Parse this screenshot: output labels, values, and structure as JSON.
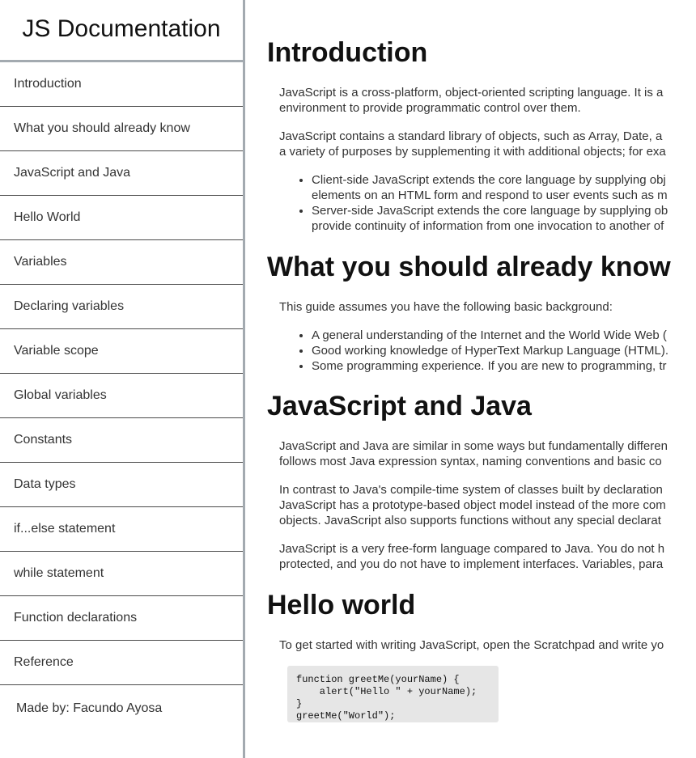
{
  "navbar": {
    "title": "JS Documentation",
    "links": [
      {
        "label": "Introduction",
        "name": "nav-link-introduction"
      },
      {
        "label": "What you should already know",
        "name": "nav-link-what-you-should-already-know"
      },
      {
        "label": "JavaScript and Java",
        "name": "nav-link-javascript-and-java"
      },
      {
        "label": "Hello World",
        "name": "nav-link-hello-world"
      },
      {
        "label": "Variables",
        "name": "nav-link-variables"
      },
      {
        "label": "Declaring variables",
        "name": "nav-link-declaring-variables"
      },
      {
        "label": "Variable scope",
        "name": "nav-link-variable-scope"
      },
      {
        "label": "Global variables",
        "name": "nav-link-global-variables"
      },
      {
        "label": "Constants",
        "name": "nav-link-constants"
      },
      {
        "label": "Data types",
        "name": "nav-link-data-types"
      },
      {
        "label": "if...else statement",
        "name": "nav-link-if-else-statement"
      },
      {
        "label": "while statement",
        "name": "nav-link-while-statement"
      },
      {
        "label": "Function declarations",
        "name": "nav-link-function-declarations"
      },
      {
        "label": "Reference",
        "name": "nav-link-reference"
      }
    ],
    "footer": "Made by: Facundo Ayosa"
  },
  "main": {
    "introduction": {
      "title": "Introduction",
      "p1_line1": "JavaScript is a cross-platform, object-oriented scripting language. It is a",
      "p1_line2": "environment to provide programmatic control over them.",
      "p2_line1": "JavaScript contains a standard library of objects, such as Array, Date, a",
      "p2_line2": "a variety of purposes by supplementing it with additional objects; for exa",
      "li1_line1": "Client-side JavaScript extends the core language by supplying obj",
      "li1_line2": "elements on an HTML form and respond to user events such as m",
      "li2_line1": "Server-side JavaScript extends the core language by supplying ob",
      "li2_line2": "provide continuity of information from one invocation to another of"
    },
    "what_you_should_know": {
      "title": "What you should already know",
      "p1": "This guide assumes you have the following basic background:",
      "li1": "A general understanding of the Internet and the World Wide Web (",
      "li2": "Good working knowledge of HyperText Markup Language (HTML).",
      "li3": "Some programming experience. If you are new to programming, tr"
    },
    "javascript_and_java": {
      "title": "JavaScript and Java",
      "p1_line1": "JavaScript and Java are similar in some ways but fundamentally differen",
      "p1_line2": "follows most Java expression syntax, naming conventions and basic co",
      "p2_line1": "In contrast to Java's compile-time system of classes built by declaration",
      "p2_line2": "JavaScript has a prototype-based object model instead of the more com",
      "p2_line3": "objects. JavaScript also supports functions without any special declarat",
      "p3_line1": "JavaScript is a very free-form language compared to Java. You do not h",
      "p3_line2": "protected, and you do not have to implement interfaces. Variables, para"
    },
    "hello_world": {
      "title": "Hello world",
      "p1": "To get started with writing JavaScript, open the Scratchpad and write yo",
      "code": "function greetMe(yourName) {\n    alert(\"Hello \" + yourName);\n}\ngreetMe(\"World\");"
    }
  }
}
